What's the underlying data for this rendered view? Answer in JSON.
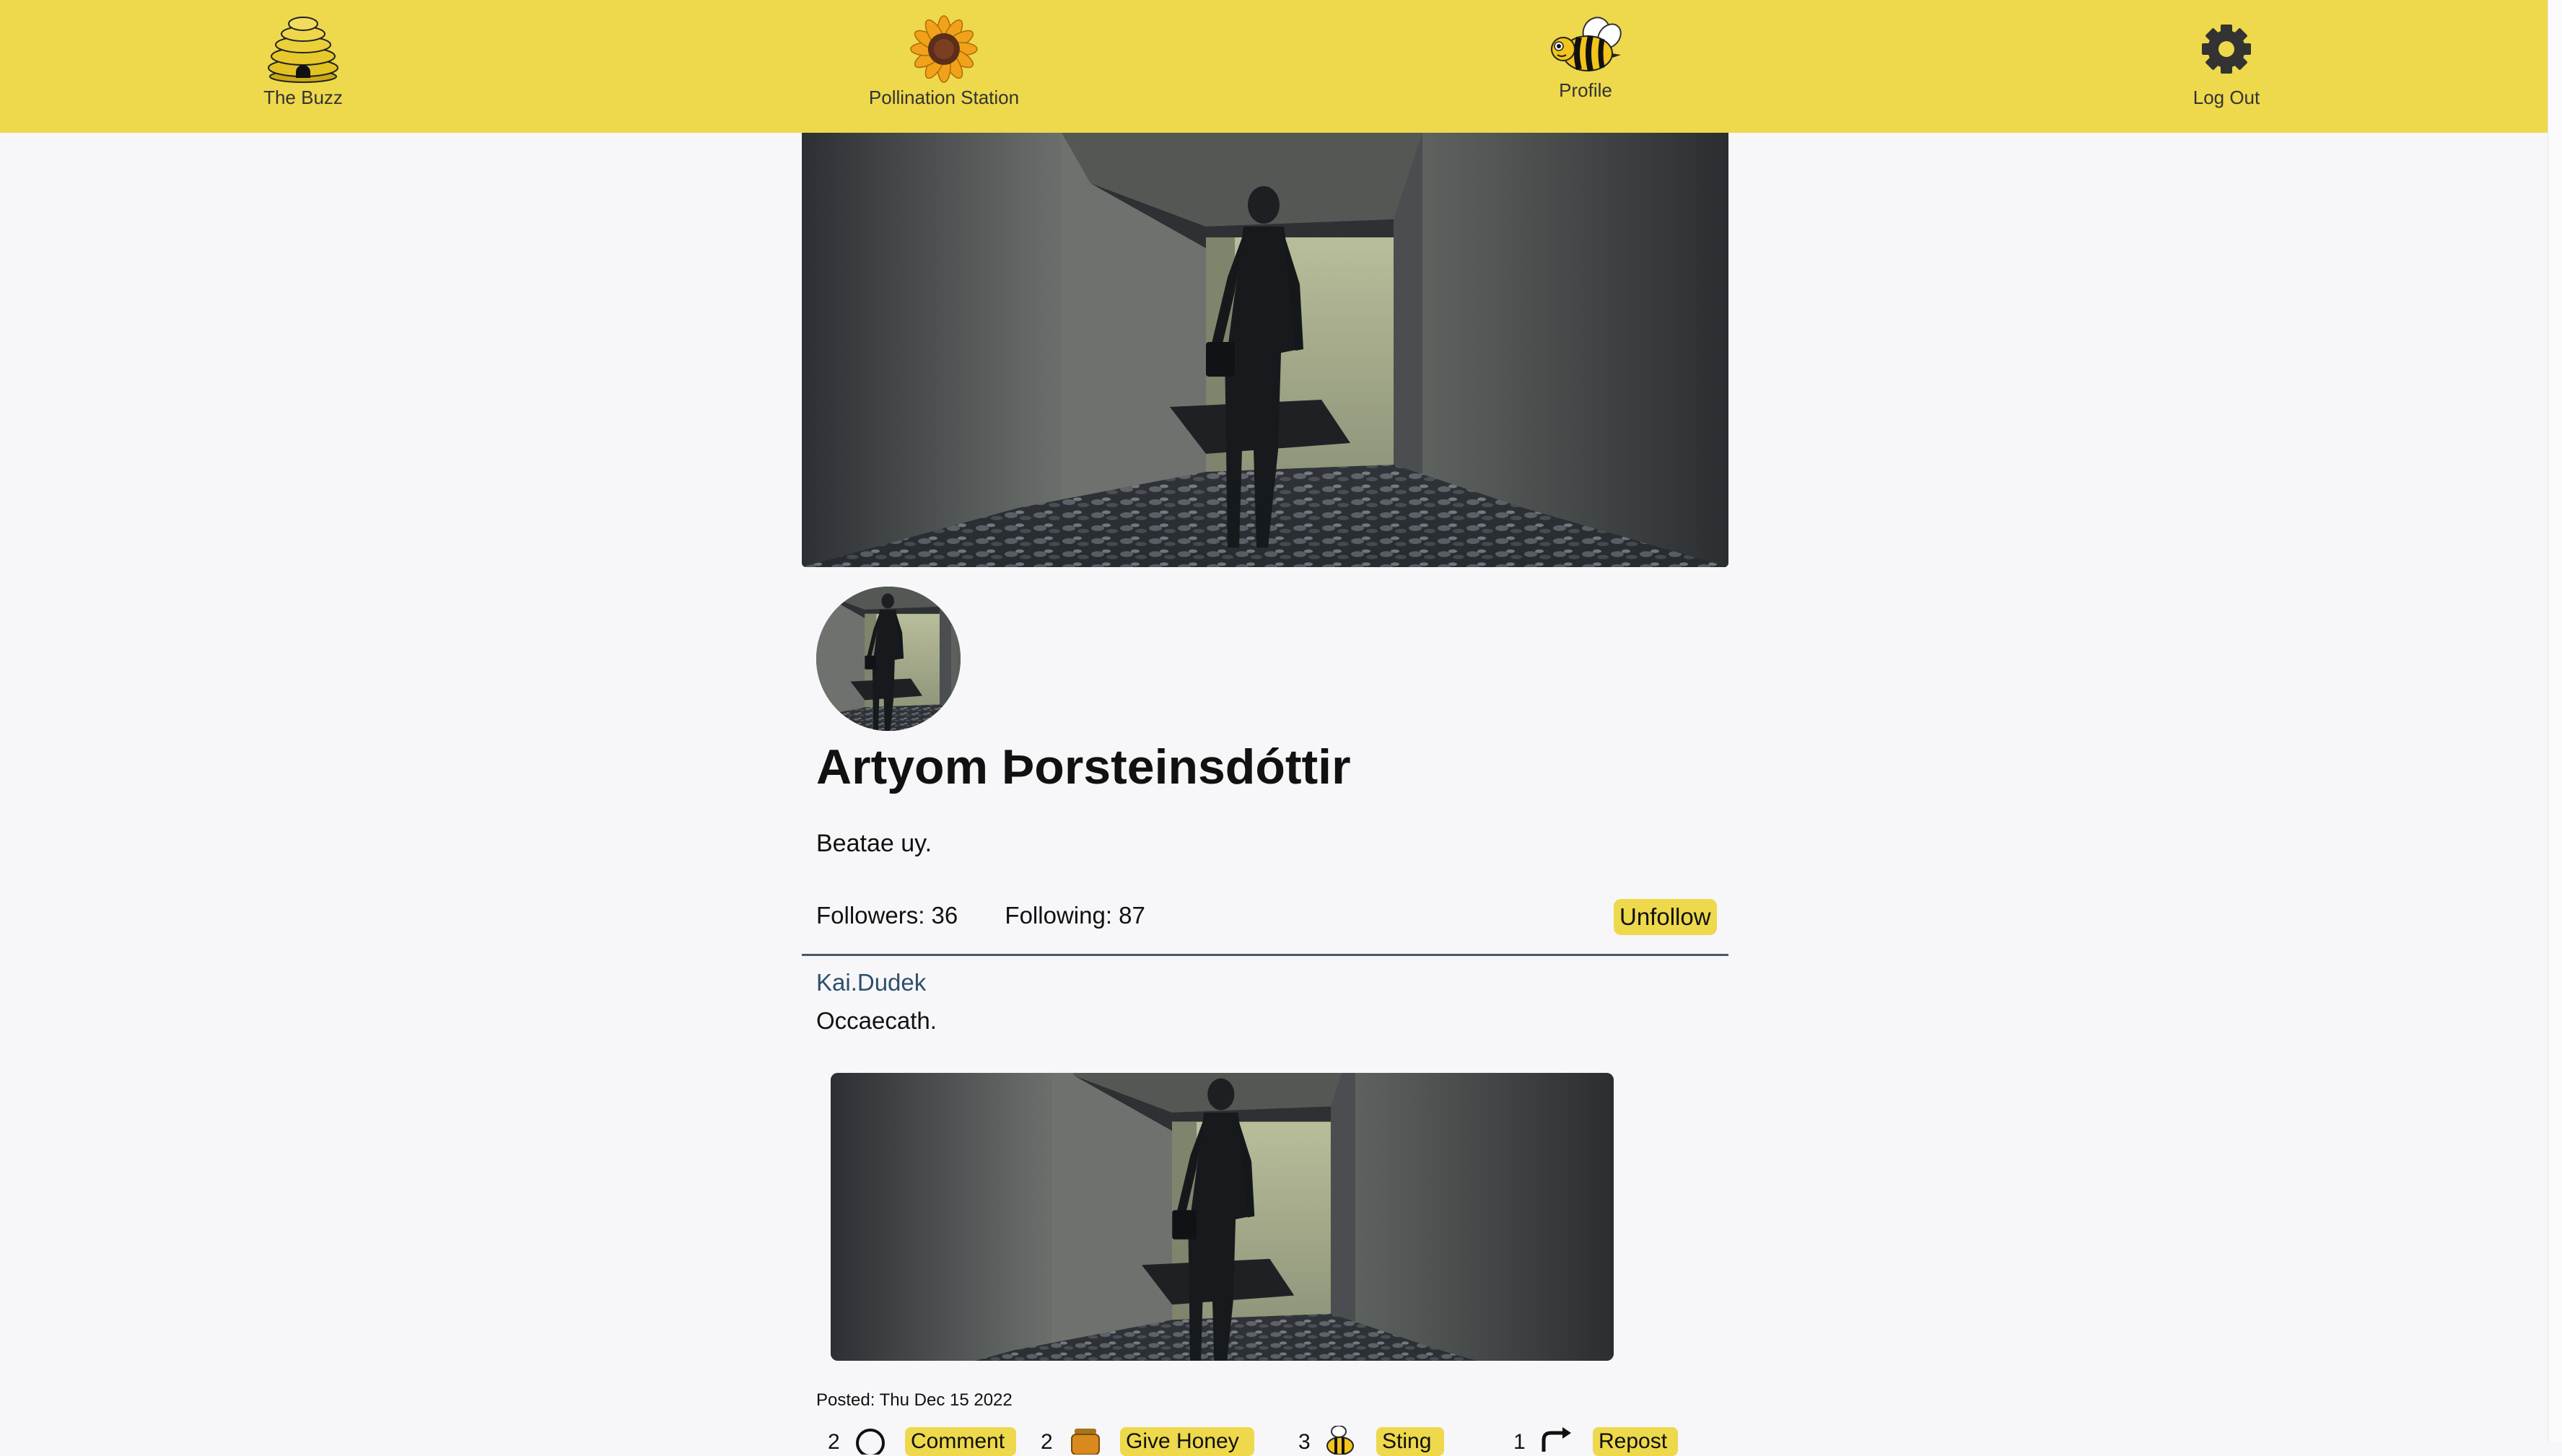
{
  "nav": {
    "buzz_label": "The Buzz",
    "pollination_label": "Pollination Station",
    "profile_label": "Profile",
    "logout_label": "Log Out"
  },
  "profile": {
    "name": "Artyom Þorsteinsdóttir",
    "bio": "Beatae uy.",
    "followers_text": "Followers: 36",
    "following_text": "Following: 87",
    "unfollow_label": "Unfollow"
  },
  "post": {
    "author": "Kai.Dudek",
    "text": "Occaecath.",
    "posted": "Posted: Thu Dec 15 2022",
    "actions": [
      {
        "count": "2",
        "icon": "comment-icon",
        "label": "Comment"
      },
      {
        "count": "2",
        "icon": "honey-jar-icon",
        "label": "Give Honey"
      },
      {
        "count": "3",
        "icon": "bee-sting-icon",
        "label": "Sting"
      },
      {
        "count": "1",
        "icon": "repost-icon",
        "label": "Repost"
      }
    ]
  },
  "colors": {
    "navbar": "#eed84c",
    "background": "#f7f7fa",
    "button": "#eed84c",
    "link": "#2f4f6a"
  },
  "icons": {
    "buzz": "beehive-icon",
    "pollination": "sunflower-icon",
    "profile": "bee-icon",
    "logout": "gear-icon"
  }
}
